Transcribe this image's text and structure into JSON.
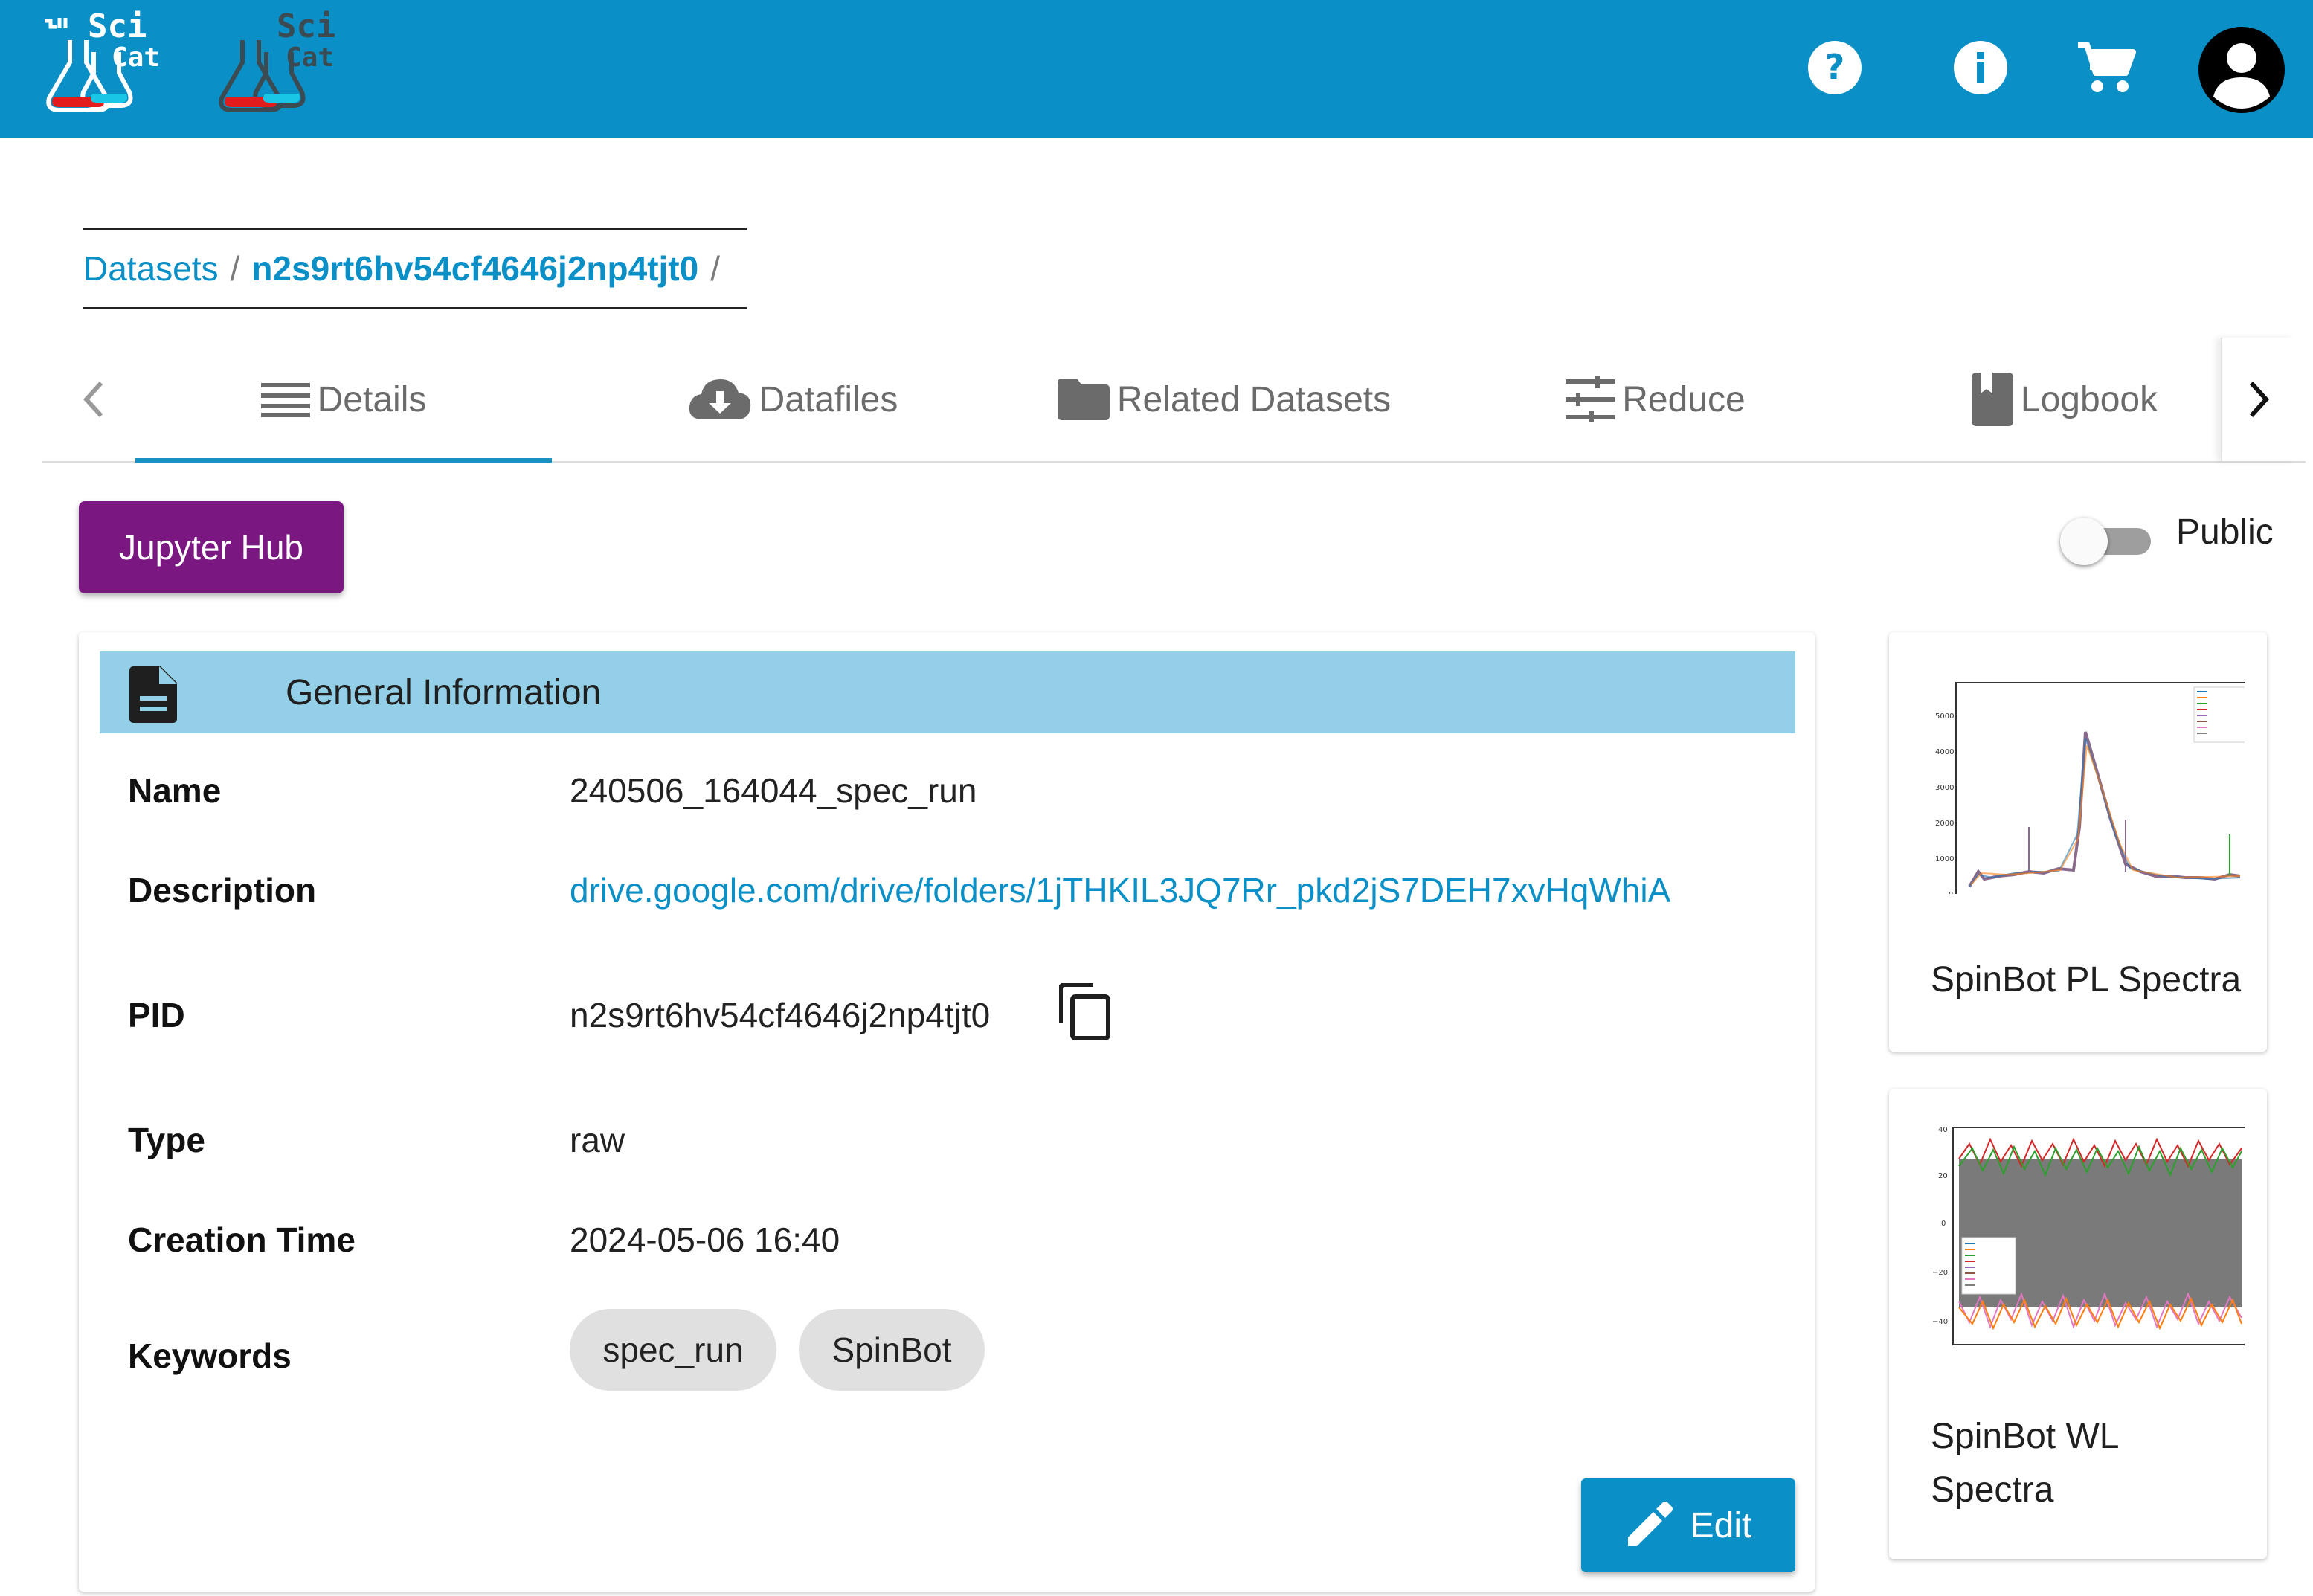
{
  "toolbar": {
    "logo_text_top": "Sci",
    "logo_text_bottom": "Cat",
    "accent_color": "#0a8fc6"
  },
  "breadcrumb": {
    "root": "Datasets",
    "separator": "/",
    "current": "n2s9rt6hv54cf4646j2np4tjt0"
  },
  "tabs": [
    {
      "label": "Details",
      "icon": "list-icon",
      "active": true
    },
    {
      "label": "Datafiles",
      "icon": "cloud-download-icon",
      "active": false
    },
    {
      "label": "Related Datasets",
      "icon": "folder-icon",
      "active": false
    },
    {
      "label": "Reduce",
      "icon": "tune-icon",
      "active": false
    },
    {
      "label": "Logbook",
      "icon": "book-icon",
      "active": false
    }
  ],
  "actions": {
    "jupyter_label": "Jupyter Hub",
    "public_label": "Public",
    "public_enabled": false,
    "edit_label": "Edit"
  },
  "general_info": {
    "title": "General Information",
    "fields": {
      "name_label": "Name",
      "name_value": "240506_164044_spec_run",
      "description_label": "Description",
      "description_value": "drive.google.com/drive/folders/1jTHKIL3JQ7Rr_pkd2jS7DEH7xvHqWhiA",
      "pid_label": "PID",
      "pid_value": "n2s9rt6hv54cf4646j2np4tjt0",
      "type_label": "Type",
      "type_value": "raw",
      "creation_label": "Creation Time",
      "creation_value": "2024-05-06 16:40",
      "keywords_label": "Keywords"
    },
    "keywords": [
      "spec_run",
      "SpinBot"
    ]
  },
  "attachments": [
    {
      "title": "SpinBot PL Spectra"
    },
    {
      "title": "SpinBot WL Spectra"
    }
  ]
}
